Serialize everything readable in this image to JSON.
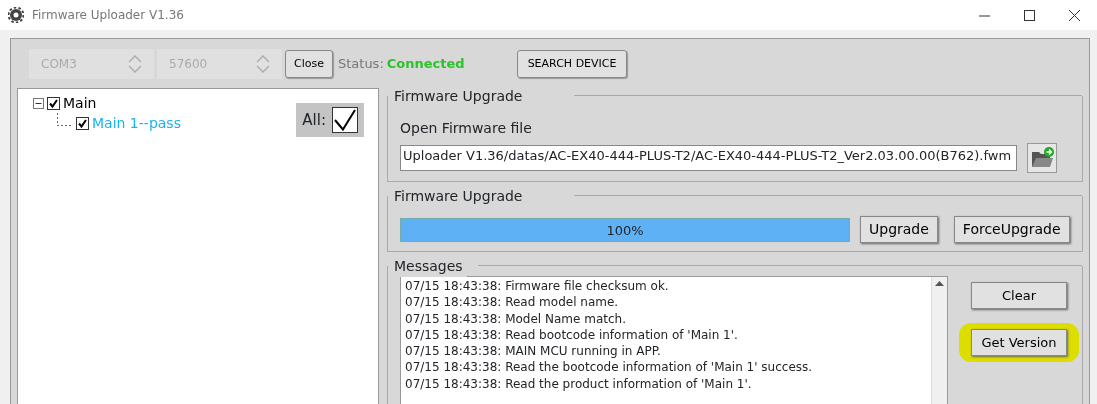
{
  "window": {
    "title": "Firmware Uploader V1.36"
  },
  "connection": {
    "port": "COM3",
    "baud": "57600",
    "disabled": true,
    "close_button": "Close",
    "status_label": "Status:",
    "status_value": "Connected",
    "search_button": "SEARCH DEVICE"
  },
  "tree": [
    {
      "label": "Main",
      "checked": true,
      "expanded": true,
      "kind": "group",
      "children": [
        {
          "label": "Main 1--pass",
          "checked": true,
          "kind": "pass"
        }
      ]
    }
  ],
  "all": {
    "label": "All:",
    "checked": true
  },
  "firmware_file": {
    "title": "Firmware Upgrade",
    "label": "Open Firmware file",
    "value": "Uploader V1.36/datas/AC-EX40-444-PLUS-T2/AC-EX40-444-PLUS-T2_Ver2.03.00.00(B762).fwm"
  },
  "upgrade": {
    "title": "Firmware Upgrade",
    "level": 1,
    "reading": "100%",
    "buttons": [
      "Upgrade",
      "ForceUpgrade"
    ]
  },
  "messages": {
    "title": "Messages",
    "lines": [
      "07/15 18:43:38: Firmware file checksum ok.",
      "07/15 18:43:38: Read model name.",
      "07/15 18:43:38: Model Name match.",
      "07/15 18:43:38: Read bootcode information of 'Main 1'.",
      "07/15 18:43:38: MAIN MCU running in APP.",
      "07/15 18:43:38: Read the bootcode information of 'Main 1' success.",
      "07/15 18:43:38: Read the product information of 'Main 1'."
    ]
  },
  "message_buttons": [
    {
      "label": "Clear",
      "highlighted": false
    },
    {
      "label": "Get Version",
      "highlighted": true
    }
  ]
}
